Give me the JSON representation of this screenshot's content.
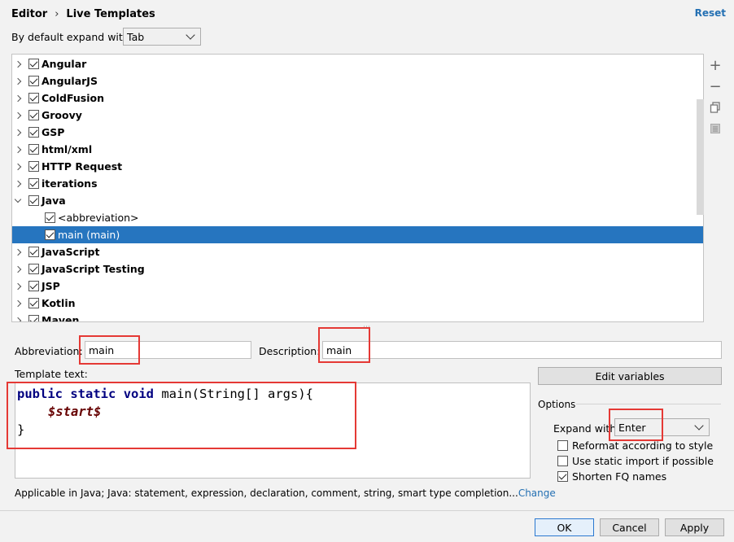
{
  "breadcrumb": {
    "parent": "Editor",
    "separator": "›",
    "current": "Live Templates"
  },
  "reset_label": "Reset",
  "default_expand": {
    "label": "By default expand with",
    "value": "Tab"
  },
  "tree": {
    "rows": [
      {
        "label": "Angular",
        "type": "group",
        "expanded": false,
        "checked": true
      },
      {
        "label": "AngularJS",
        "type": "group",
        "expanded": false,
        "checked": true
      },
      {
        "label": "ColdFusion",
        "type": "group",
        "expanded": false,
        "checked": true
      },
      {
        "label": "Groovy",
        "type": "group",
        "expanded": false,
        "checked": true
      },
      {
        "label": "GSP",
        "type": "group",
        "expanded": false,
        "checked": true
      },
      {
        "label": "html/xml",
        "type": "group",
        "expanded": false,
        "checked": true
      },
      {
        "label": "HTTP Request",
        "type": "group",
        "expanded": false,
        "checked": true
      },
      {
        "label": "iterations",
        "type": "group",
        "expanded": false,
        "checked": true
      },
      {
        "label": "Java",
        "type": "group",
        "expanded": true,
        "checked": true
      },
      {
        "label": "<abbreviation>",
        "type": "item",
        "checked": true,
        "selected": false
      },
      {
        "label": "main (main)",
        "type": "item",
        "checked": true,
        "selected": true
      },
      {
        "label": "JavaScript",
        "type": "group",
        "expanded": false,
        "checked": true
      },
      {
        "label": "JavaScript Testing",
        "type": "group",
        "expanded": false,
        "checked": true
      },
      {
        "label": "JSP",
        "type": "group",
        "expanded": false,
        "checked": true
      },
      {
        "label": "Kotlin",
        "type": "group",
        "expanded": false,
        "checked": true
      },
      {
        "label": "Maven",
        "type": "group",
        "expanded": false,
        "checked": true
      }
    ]
  },
  "tools": {
    "add": "+",
    "remove": "−",
    "copy_icon": "copy-icon",
    "restore_icon": "list-icon"
  },
  "abbreviation": {
    "label": "Abbreviation:",
    "value": "main"
  },
  "description": {
    "label": "Description:",
    "value": "main"
  },
  "template_text": {
    "label": "Template text:",
    "line1": [
      "public",
      " ",
      "static",
      " ",
      "void",
      " main(String[] args){"
    ],
    "line2": "$start$",
    "line3": "}"
  },
  "edit_variables_label": "Edit variables",
  "options": {
    "title": "Options",
    "expand_with_label": "Expand with",
    "expand_with_value": "Enter",
    "reformat": {
      "label": "Reformat according to style",
      "checked": false
    },
    "static_import": {
      "label": "Use static import if possible",
      "checked": false
    },
    "shorten_fq": {
      "label": "Shorten FQ names",
      "checked": true
    }
  },
  "applicable": {
    "text": "Applicable in Java; Java: statement, expression, declaration, comment, string, smart type completion...",
    "link": "Change"
  },
  "buttons": {
    "ok": "OK",
    "cancel": "Cancel",
    "apply": "Apply"
  }
}
